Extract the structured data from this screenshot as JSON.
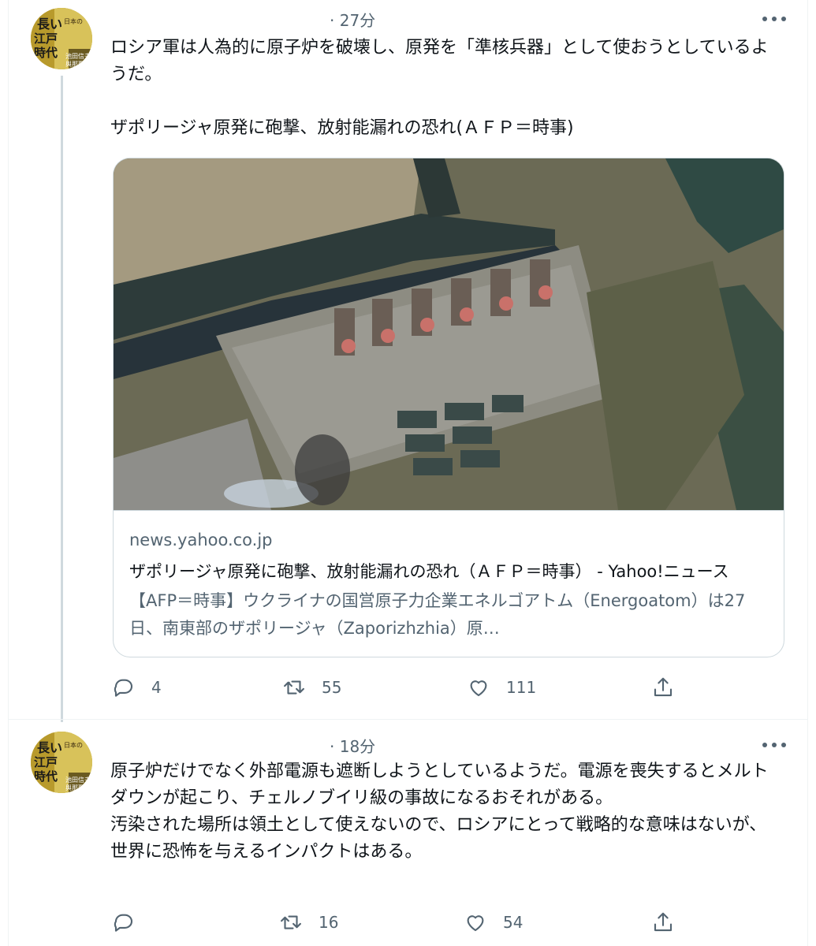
{
  "tweets": [
    {
      "time": "· 27分",
      "avatar_text": "長い江戸時代のおわり 池田信夫 與那覇潤",
      "text": "ロシア軍は人為的に原子炉を破壊し、原発を「準核兵器」として使おうとしているようだ。\n\nザポリージャ原発に砲撃、放射能漏れの恐れ(ＡＦＰ＝時事)",
      "card": {
        "domain": "news.yahoo.co.jp",
        "title": "ザポリージャ原発に砲撃、放射能漏れの恐れ（ＡＦＰ＝時事） - Yahoo!ニュース",
        "description": "【AFP＝時事】ウクライナの国営原子力企業エネルゴアトム（Energoatom）は27日、南東部のザポリージャ（Zaporizhzhia）原…"
      },
      "actions": {
        "reply": "4",
        "retweet": "55",
        "like": "111"
      }
    },
    {
      "time": "· 18分",
      "avatar_text": "長い江戸時代のおわり 池田信夫 與那覇潤",
      "text": "原子炉だけでなく外部電源も遮断しようとしているようだ。電源を喪失するとメルトダウンが起こり、チェルノブイリ級の事故になるおそれがある。\n汚染された場所は領土として使えないので、ロシアにとって戦略的な意味はないが、世界に恐怖を与えるインパクトはある。",
      "actions": {
        "reply": "",
        "retweet": "16",
        "like": "54"
      }
    }
  ],
  "icons": [
    "avatar",
    "more-icon",
    "reply-icon",
    "retweet-icon",
    "like-icon",
    "share-icon"
  ],
  "colors": {
    "text": "#0f1419",
    "secondary": "#536471",
    "border": "#cfd9de"
  }
}
